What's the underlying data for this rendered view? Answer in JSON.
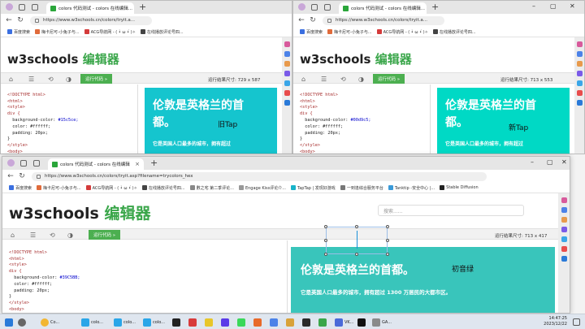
{
  "browser": {
    "tab_title": "colors 代码测试 - colors 在线编辑...",
    "tab_title_short": "colors 代码测试 - colors 在线编辑",
    "url_top": "https://www.w3schools.cn/colors/tryit.a...",
    "url_bottom": "https://www.w3schools.cn/colors/tryit.asp?filename=trycolors_hex",
    "bookmarks_short": [
      "百度搜索",
      "梅卡尼可-小兔子与...",
      "ACG导航网 - ( •̀ ω •́ )✧",
      "在线播放评论号四..."
    ],
    "bookmarks": [
      "百度搜索",
      "梅卡尼可-小兔子与...",
      "ACG导航网 - ( •̀ ω •́ )✧",
      "在线播放评论号四...",
      "數之宅 第二季评论...",
      "Engage Kiss评论介...",
      "TapTap | 发现好游戏",
      "一到逢综合服务平台",
      "Tanktip -安全中心 |...",
      "Stable Diffusion"
    ]
  },
  "editor": {
    "logo_main": "w3schools",
    "logo_sub": "编辑器",
    "run_label": "运行代码 »",
    "search_placeholder": "搜索......",
    "size_left": "运行结果尺寸: 729 x 587",
    "size_right": "运行结果尺寸: 713 x 553",
    "size_bottom": "运行结果尺寸: 713 x 417"
  },
  "code": {
    "l1": "<!DOCTYPE html>",
    "l2": "<html>",
    "l3": "<style>",
    "l4": "div {",
    "bg_label": "  background-color: ",
    "bg_left": "#15c5ce;",
    "bg_right": "#00d9c5;",
    "bg_bottom": "#39C5BB;",
    "color_line": "  color: #ffffff;",
    "padding_line": "  padding: 20px;",
    "l8": "}",
    "l9": "</style>",
    "l10": "<body>"
  },
  "result": {
    "heading": "伦敦是英格兰的首都。",
    "heading_a": "伦敦是英格兰的首",
    "heading_b": "都。",
    "paragraph": "它是英国人口最多的城市，拥有超过 1300 万居民的大都市区。",
    "paragraph_short": "它是英国人口最多的城市，拥有超过",
    "note_left": "旧Tap",
    "note_right": "新Tap",
    "note_bottom": "初音绿"
  },
  "taskbar": {
    "items": [
      "Co...",
      "colo...",
      "colo...",
      "colo...",
      "VK...",
      "GA..."
    ],
    "time": "14:47:25",
    "date": "2023/12/22"
  },
  "colors": {
    "left": "#15c5ce",
    "right": "#00d9c5",
    "bottom": "#39C5BB",
    "accent": "#4caf50"
  }
}
